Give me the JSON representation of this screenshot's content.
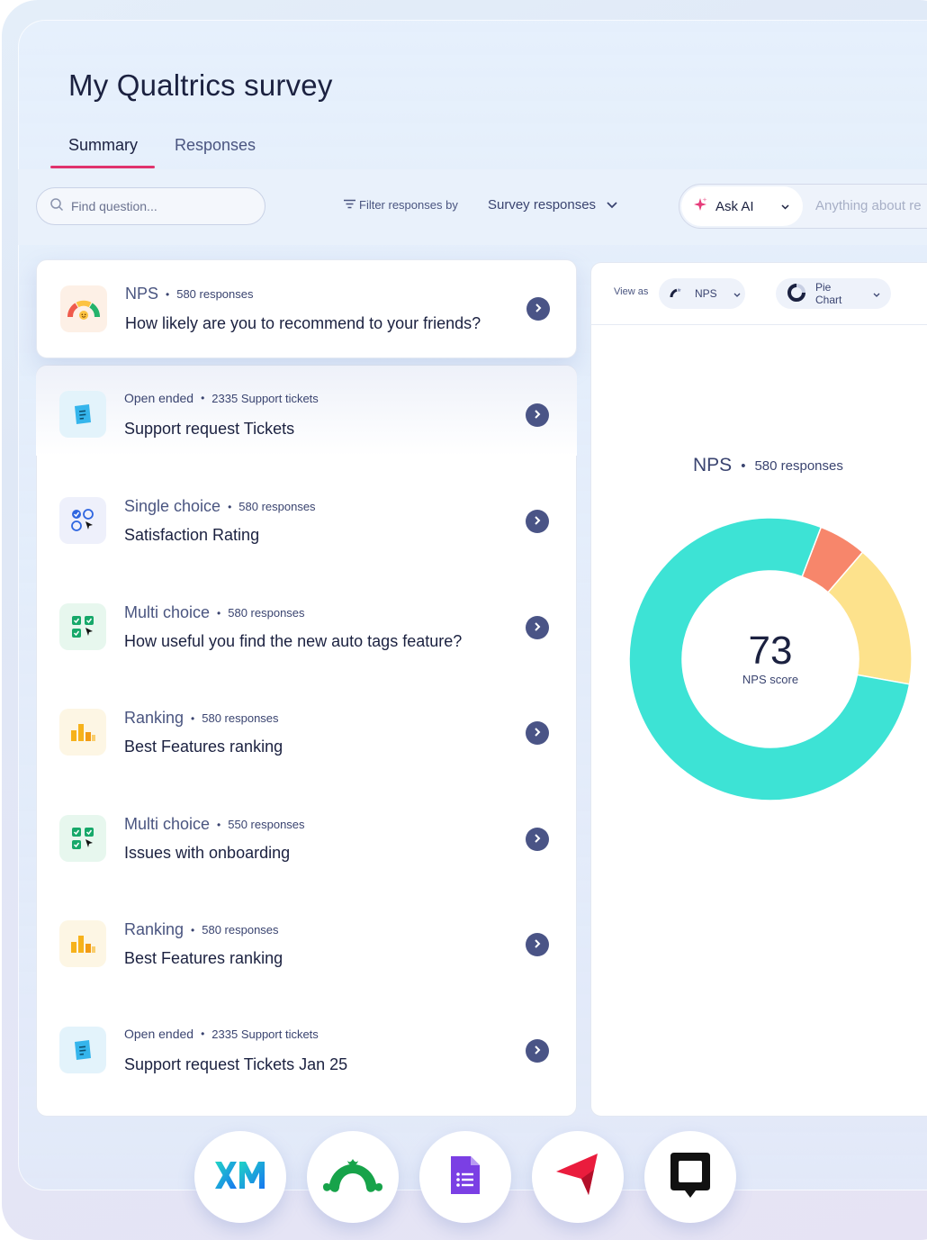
{
  "header": {
    "title": "My Qualtrics survey"
  },
  "tabs": [
    {
      "label": "Summary",
      "active": true
    },
    {
      "label": "Responses",
      "active": false
    }
  ],
  "toolbar": {
    "search_placeholder": "Find question...",
    "filter_label": "Filter responses by",
    "survey_select_value": "Survey responses",
    "ask_ai_label": "Ask AI",
    "ask_placeholder": "Anything about re"
  },
  "questions": [
    {
      "type": "NPS",
      "count": "580 responses",
      "text": "How likely are you to recommend to your friends?",
      "icon": "gauge-icon"
    },
    {
      "type": "Open ended",
      "count": "2335 Support tickets",
      "text": "Support request Tickets",
      "icon": "document-icon"
    },
    {
      "type": "Single choice",
      "count": "580 responses",
      "text": "Satisfaction Rating",
      "icon": "single-choice-icon"
    },
    {
      "type": "Multi choice",
      "count": "580 responses",
      "text": "How useful you find the new auto tags feature?",
      "icon": "multi-choice-icon"
    },
    {
      "type": "Ranking",
      "count": "580 responses",
      "text": "Best Features ranking",
      "icon": "bar-ranking-icon"
    },
    {
      "type": "Multi choice",
      "count": "550 responses",
      "text": "Issues with onboarding",
      "icon": "multi-choice-icon"
    },
    {
      "type": "Ranking",
      "count": "580 responses",
      "text": "Best Features ranking",
      "icon": "bar-ranking-icon"
    },
    {
      "type": "Open ended",
      "count": "2335 Support tickets",
      "text": "Support request Tickets Jan 25",
      "icon": "document-icon"
    }
  ],
  "chart_panel": {
    "view_as_label": "View as",
    "view_as_value": "NPS",
    "chart_type_value": "Pie Chart",
    "title": "NPS",
    "count": "580 responses",
    "score": "73",
    "score_label": "NPS score"
  },
  "chart_data": {
    "type": "pie",
    "values": [
      5.5,
      16.5,
      78
    ],
    "colors": [
      "#f7866b",
      "#fde28c",
      "#3de3d5"
    ],
    "center_value": "73"
  },
  "dock": [
    {
      "name": "XM",
      "icon": "xm-logo-icon",
      "color": "#1aa3f0"
    },
    {
      "name": "SurveyMonkey",
      "icon": "monkey-logo-icon",
      "color": "#17a34a"
    },
    {
      "name": "Google Forms",
      "icon": "forms-logo-icon",
      "color": "#7b3fe4"
    },
    {
      "name": "Pointer",
      "icon": "red-arrow-logo-icon",
      "color": "#ea1c3d"
    },
    {
      "name": "Chat",
      "icon": "chat-square-icon",
      "color": "#111111"
    }
  ],
  "colors": {
    "accent": "#e0336d",
    "go_button": "#4a5486",
    "text_primary": "#1b2140"
  }
}
